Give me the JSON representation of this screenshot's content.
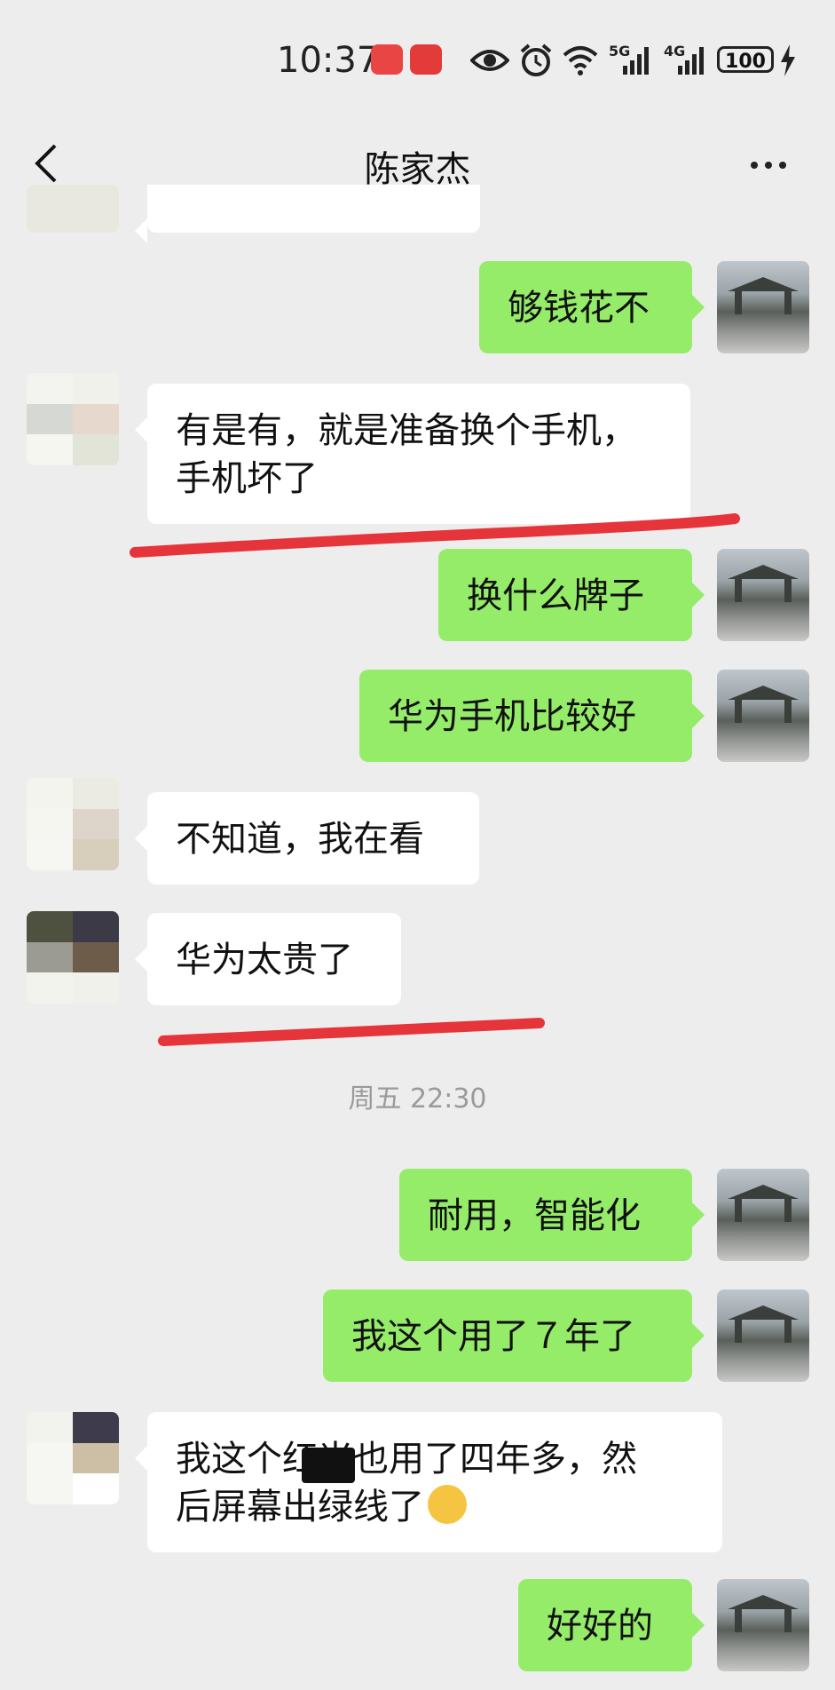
{
  "status_bar": {
    "time": "10:37",
    "network_1": "5G",
    "network_2": "4G",
    "battery": "100",
    "icons": [
      "huawei-video-icon",
      "huawei-app-icon",
      "eye-icon",
      "alarm-icon",
      "wifi-icon",
      "signal-icon",
      "charging-icon"
    ]
  },
  "nav": {
    "title": "陈家杰",
    "back_icon": "chevron-left-icon",
    "more_icon": "more-dots-icon"
  },
  "messages": [
    {
      "side": "out",
      "text": "够钱花不"
    },
    {
      "side": "in",
      "text": "有是有，就是准备换个手机，\n手机坏了"
    },
    {
      "side": "out",
      "text": "换什么牌子"
    },
    {
      "side": "out",
      "text": "华为手机比较好"
    },
    {
      "side": "in",
      "text": "不知道，我在看"
    },
    {
      "side": "in",
      "text": "华为太贵了"
    },
    {
      "side": "out",
      "text": "耐用，智能化"
    },
    {
      "side": "out",
      "text": "我这个用了７年了"
    },
    {
      "side": "in",
      "text": "我这个红米也用了四年多，然\n后屏幕出绿线了"
    },
    {
      "side": "out",
      "text": "好好的"
    }
  ],
  "timestamp": "周五 22:30",
  "colors": {
    "background": "#ededed",
    "outgoing_bubble": "#95ec69",
    "incoming_bubble": "#ffffff",
    "annotation_red": "#e5343a"
  }
}
